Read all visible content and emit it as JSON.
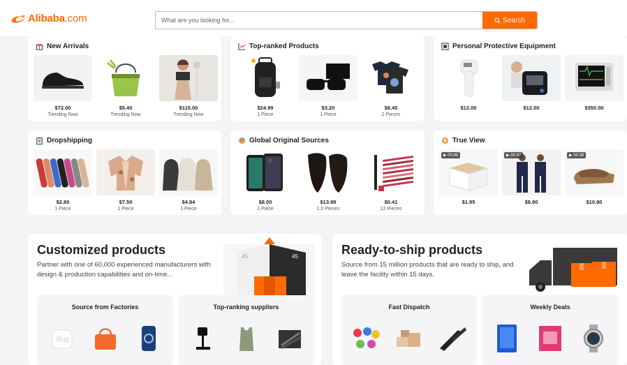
{
  "header": {
    "logo_text": "Alibaba",
    "logo_suffix": ".com",
    "search_placeholder": "What are you looking for...",
    "search_button": "Search",
    "brand_color": "#ff6a00"
  },
  "cards": [
    {
      "title": "New Arrivals",
      "icon": "gift-icon",
      "items": [
        {
          "price": "$72.00",
          "sub": "Trending Now"
        },
        {
          "price": "$5.40",
          "sub": "Trending Now"
        },
        {
          "price": "$115.00",
          "sub": "Trending Now"
        }
      ]
    },
    {
      "title": "Top-ranked Products",
      "icon": "trend-up-icon",
      "items": [
        {
          "price": "$24.99",
          "sub": "1 Piece"
        },
        {
          "price": "$3.20",
          "sub": "1 Piece"
        },
        {
          "price": "$8.40",
          "sub": "2 Pieces"
        }
      ]
    },
    {
      "title": "Personal Protective Equipment",
      "icon": "shield-box-icon",
      "items": [
        {
          "price": "$12.00",
          "sub": ""
        },
        {
          "price": "$12.00",
          "sub": ""
        },
        {
          "price": "$350.00",
          "sub": ""
        }
      ]
    },
    {
      "title": "Dropshipping",
      "icon": "clipboard-icon",
      "items": [
        {
          "price": "$2.80",
          "sub": "1 Piece"
        },
        {
          "price": "$7.50",
          "sub": "1 Piece"
        },
        {
          "price": "$4.84",
          "sub": "1 Piece"
        }
      ]
    },
    {
      "title": "Global Original Sources",
      "icon": "globe-icon",
      "items": [
        {
          "price": "$8.00",
          "sub": "1 Piece"
        },
        {
          "price": "$13.98",
          "sub": "1.0 Pieces"
        },
        {
          "price": "$0.41",
          "sub": "12 Pieces"
        }
      ]
    },
    {
      "title": "True View",
      "icon": "eye-icon",
      "items": [
        {
          "price": "$1.95",
          "sub": "",
          "video": "00:45"
        },
        {
          "price": "$8.90",
          "sub": "",
          "video": "00:47"
        },
        {
          "price": "$10.80",
          "sub": "",
          "video": "00:38"
        }
      ]
    }
  ],
  "customized": {
    "title": "Customized products",
    "desc": "Partner with one of 60,000 experienced manufacturers with design & production capabilities and on-time...",
    "tiles": [
      "Source from Factories",
      "Top-ranking suppliers"
    ],
    "chart_labels": [
      "45",
      "45"
    ]
  },
  "ready": {
    "title": "Ready-to-ship products",
    "desc": "Source from 15 million products that are ready to ship, and leave the facility within 15 days.",
    "tiles": [
      "Fast Dispatch",
      "Weekly Deals"
    ]
  }
}
